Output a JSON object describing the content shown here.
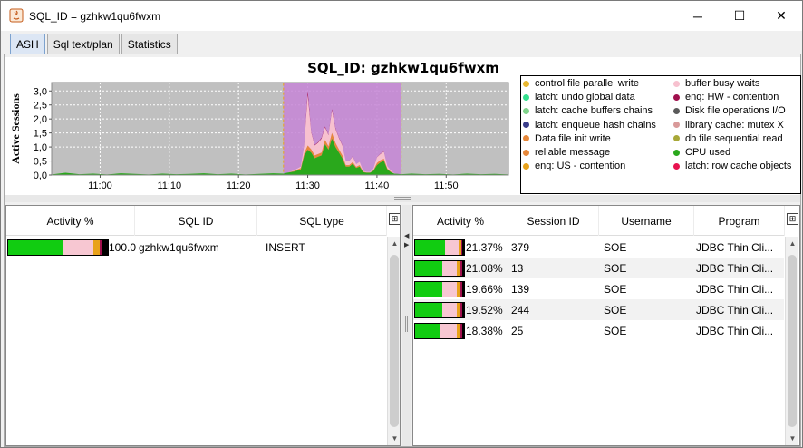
{
  "window": {
    "title": "SQL_ID = gzhkw1qu6fwxm",
    "minimize_glyph": "─",
    "maximize_glyph": "☐",
    "close_glyph": "✕"
  },
  "tabs": [
    {
      "label": "ASH",
      "active": true
    },
    {
      "label": "Sql text/plan",
      "active": false
    },
    {
      "label": "Statistics",
      "active": false
    }
  ],
  "chart_data": {
    "type": "area",
    "title": "SQL_ID: gzhkw1qu6fwxm",
    "ylabel": "Active Sessions",
    "xlabel": "",
    "y_ticks": [
      "0,0",
      "0,5",
      "1,0",
      "1,5",
      "2,0",
      "2,5",
      "3,0"
    ],
    "ylim": [
      0,
      3.3
    ],
    "x_ticks": [
      "11:00",
      "11:10",
      "11:20",
      "11:30",
      "11:40",
      "11:50"
    ],
    "x_tick_minutes": [
      660,
      670,
      680,
      690,
      700,
      710
    ],
    "xlim_minutes": [
      653,
      719
    ],
    "selection_range_minutes": [
      686.5,
      703.5
    ],
    "grid": true,
    "stack_order": [
      "CPU used",
      "reliable message",
      "buffer busy waits",
      "enq: HW - contention"
    ],
    "series": [
      {
        "name": "CPU used",
        "color": "#2aa81c"
      },
      {
        "name": "reliable message",
        "color": "#e7883a"
      },
      {
        "name": "buffer busy waits",
        "color": "#f7c1cf"
      },
      {
        "name": "enq: HW - contention",
        "color": "#a0104d"
      }
    ],
    "x_minutes": [
      653,
      655,
      657,
      659,
      661,
      663,
      665,
      667,
      669,
      671,
      673,
      675,
      677,
      679,
      681,
      683,
      685,
      686.5,
      687,
      688,
      689,
      689.5,
      690,
      690.5,
      691,
      691.5,
      692,
      692.5,
      693,
      693.5,
      694,
      694.5,
      695,
      695.5,
      696,
      696.5,
      697,
      697.5,
      698,
      698.5,
      699,
      699.5,
      700,
      700.5,
      701,
      701.5,
      702,
      702.5,
      703,
      703.5,
      705,
      707,
      709,
      711,
      713,
      715,
      717,
      719
    ],
    "stacks": [
      [
        0.02,
        0.08,
        0.03,
        0.05,
        0.02,
        0.06,
        0.04,
        0.02,
        0.05,
        0.03,
        0.04,
        0.06,
        0.03,
        0.05,
        0.02,
        0.04,
        0.06,
        0.05,
        0.08,
        0.12,
        0.2,
        0.7,
        0.9,
        0.8,
        0.6,
        0.65,
        0.7,
        1.1,
        0.9,
        1.3,
        1.0,
        0.8,
        0.6,
        0.3,
        0.3,
        0.4,
        0.25,
        0.3,
        0.1,
        0.08,
        0.08,
        0.15,
        0.35,
        0.45,
        0.5,
        0.2,
        0.1,
        0.05,
        0.04,
        0.03,
        0.05,
        0.03,
        0.04,
        0.02,
        0.05,
        0.03,
        0.04,
        0.02
      ],
      [
        0,
        0,
        0,
        0,
        0,
        0,
        0,
        0,
        0,
        0,
        0,
        0,
        0,
        0,
        0,
        0,
        0,
        0,
        0,
        0.02,
        0.05,
        0.08,
        0.15,
        0.12,
        0.1,
        0.1,
        0.1,
        0.15,
        0.12,
        0.2,
        0.15,
        0.12,
        0.1,
        0.05,
        0.05,
        0.06,
        0.04,
        0.05,
        0.02,
        0.01,
        0.01,
        0.02,
        0.08,
        0.08,
        0.08,
        0.03,
        0.02,
        0,
        0,
        0,
        0,
        0,
        0,
        0,
        0,
        0,
        0,
        0
      ],
      [
        0,
        0,
        0,
        0,
        0,
        0,
        0,
        0,
        0,
        0,
        0,
        0,
        0,
        0,
        0,
        0,
        0,
        0,
        0,
        0.02,
        0.05,
        0.3,
        1.8,
        0.6,
        0.35,
        0.4,
        0.5,
        0.45,
        0.4,
        0.8,
        0.5,
        0.4,
        0.35,
        0.15,
        0.15,
        0.2,
        0.1,
        0.12,
        0.03,
        0.02,
        0.02,
        0.06,
        0.2,
        0.22,
        0.25,
        0.08,
        0.04,
        0.01,
        0,
        0,
        0,
        0,
        0,
        0,
        0,
        0,
        0,
        0
      ],
      [
        0,
        0,
        0,
        0,
        0,
        0,
        0,
        0,
        0,
        0,
        0,
        0,
        0,
        0,
        0,
        0,
        0,
        0,
        0,
        0,
        0,
        0.02,
        0.15,
        0.03,
        0.02,
        0.02,
        0.03,
        0.03,
        0.02,
        0.05,
        0.03,
        0.02,
        0.02,
        0,
        0,
        0.01,
        0,
        0,
        0,
        0,
        0,
        0,
        0.01,
        0.01,
        0.01,
        0,
        0,
        0,
        0,
        0,
        0,
        0,
        0,
        0,
        0,
        0,
        0,
        0
      ]
    ],
    "legend_position": "right",
    "legend": [
      {
        "name": "control file parallel write",
        "color": "#e8b730"
      },
      {
        "name": "buffer busy waits",
        "color": "#f7c1cf"
      },
      {
        "name": "latch: undo global data",
        "color": "#35e08f"
      },
      {
        "name": "enq: HW - contention",
        "color": "#a0104d"
      },
      {
        "name": "latch: cache buffers chains",
        "color": "#7fd38a"
      },
      {
        "name": "Disk file operations I/O",
        "color": "#5a5a5a"
      },
      {
        "name": "latch: enqueue hash chains",
        "color": "#3a3d8a"
      },
      {
        "name": "library cache: mutex X",
        "color": "#d99a9a"
      },
      {
        "name": "Data file init write",
        "color": "#e7883a"
      },
      {
        "name": "db file sequential read",
        "color": "#a8a838"
      },
      {
        "name": "reliable message",
        "color": "#e7883a"
      },
      {
        "name": "CPU used",
        "color": "#2aa81c"
      },
      {
        "name": "enq: US - contention",
        "color": "#e8a21a"
      },
      {
        "name": "latch: row cache objects",
        "color": "#e8124f"
      }
    ]
  },
  "left_table": {
    "columns": [
      "Activity %",
      "SQL ID",
      "SQL type"
    ],
    "rows": [
      {
        "activity": "100.0",
        "sql_id": "gzhkw1qu6fwxm",
        "sql_type": "INSERT",
        "bar": [
          0.55,
          0.3,
          0.07,
          0.03,
          0.02,
          0.03
        ]
      }
    ]
  },
  "right_table": {
    "columns": [
      "Activity %",
      "Session ID",
      "Username",
      "Program"
    ],
    "rows": [
      {
        "activity": "21.37%",
        "session_id": "379",
        "username": "SOE",
        "program": "JDBC Thin Cli...",
        "bar": [
          0.62,
          0.26,
          0.06,
          0.03,
          0.03
        ]
      },
      {
        "activity": "21.08%",
        "session_id": "13",
        "username": "SOE",
        "program": "JDBC Thin Cli...",
        "bar": [
          0.55,
          0.3,
          0.08,
          0.04,
          0.03
        ]
      },
      {
        "activity": "19.66%",
        "session_id": "139",
        "username": "SOE",
        "program": "JDBC Thin Cli...",
        "bar": [
          0.55,
          0.3,
          0.08,
          0.04,
          0.03
        ]
      },
      {
        "activity": "19.52%",
        "session_id": "244",
        "username": "SOE",
        "program": "JDBC Thin Cli...",
        "bar": [
          0.55,
          0.3,
          0.08,
          0.04,
          0.03
        ]
      },
      {
        "activity": "18.38%",
        "session_id": "25",
        "username": "SOE",
        "program": "JDBC Thin Cli...",
        "bar": [
          0.5,
          0.35,
          0.08,
          0.04,
          0.03
        ]
      }
    ]
  },
  "bar_colors": [
    "#11cc11",
    "#f7c7d2",
    "#e8a21a",
    "#a0104d",
    "#000000",
    "#e7883a"
  ],
  "icons": {
    "column_chooser": "column-chooser-icon",
    "scroll_up": "▲",
    "scroll_down": "▼"
  }
}
